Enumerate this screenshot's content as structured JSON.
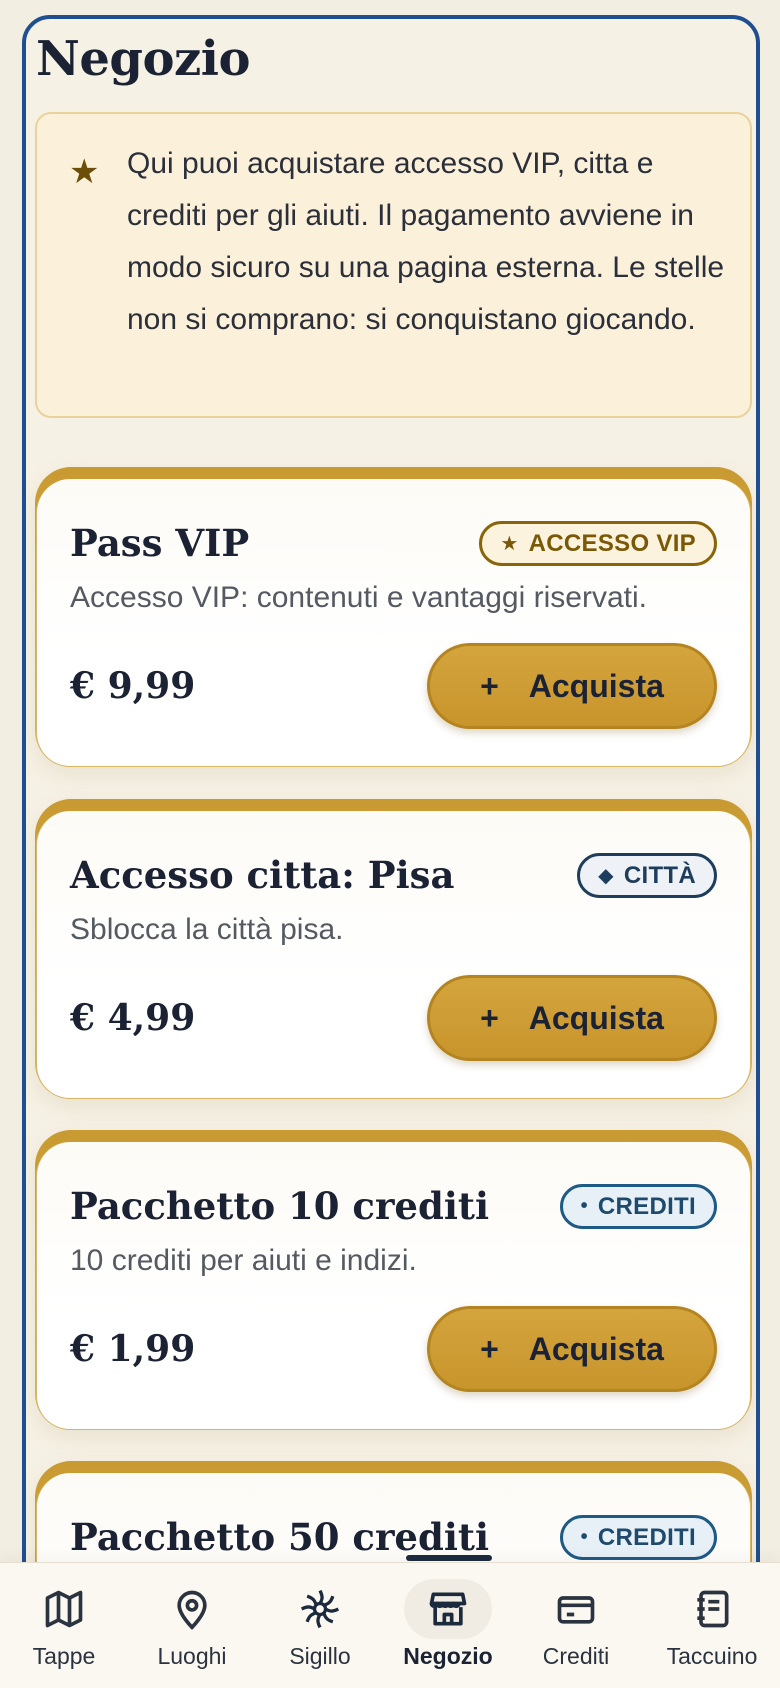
{
  "page": {
    "title": "Negozio"
  },
  "info": {
    "icon": "star-icon",
    "text": "Qui puoi acquistare accesso VIP, citta e crediti per gli aiuti. Il pagamento avviene in modo sicuro su una pagina esterna. Le stelle non si comprano: si conquistano giocando."
  },
  "products": [
    {
      "title": "Pass VIP",
      "badge_icon": "★",
      "badge": "ACCESSO VIP",
      "description": "Accesso VIP: contenuti e vantaggi riservati.",
      "price": "€ 9,99",
      "buy_label": "Acquista",
      "buy_icon": "+"
    },
    {
      "title": "Accesso citta: Pisa",
      "badge_icon": "◆",
      "badge": "CITTÀ",
      "description": "Sblocca la città pisa.",
      "price": "€ 4,99",
      "buy_label": "Acquista",
      "buy_icon": "+"
    },
    {
      "title": "Pacchetto 10 crediti",
      "badge_icon": "•",
      "badge": "CREDITI",
      "description": "10 crediti per aiuti e indizi.",
      "price": "€ 1,99",
      "buy_label": "Acquista",
      "buy_icon": "+"
    },
    {
      "title": "Pacchetto 50 crediti",
      "badge_icon": "•",
      "badge": "CREDITI"
    }
  ],
  "nav": {
    "items": [
      {
        "label": "Tappe",
        "icon": "map-icon"
      },
      {
        "label": "Luoghi",
        "icon": "location-pin-icon"
      },
      {
        "label": "Sigillo",
        "icon": "seal-icon"
      },
      {
        "label": "Negozio",
        "icon": "store-icon",
        "active": true
      },
      {
        "label": "Crediti",
        "icon": "credit-card-icon"
      },
      {
        "label": "Taccuino",
        "icon": "notebook-icon"
      }
    ]
  },
  "colors": {
    "accent": "#c8952c",
    "frame": "#1f4e91",
    "text": "#1b2233"
  }
}
